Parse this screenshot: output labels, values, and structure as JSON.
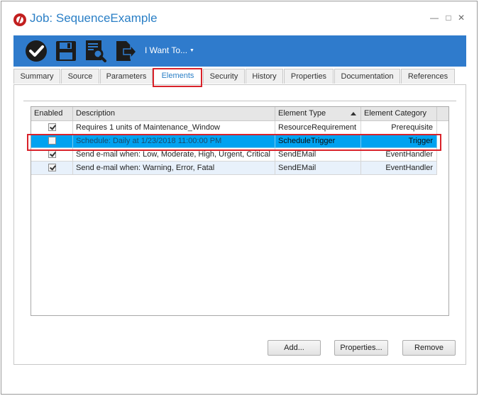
{
  "window": {
    "title": "Job: SequenceExample",
    "controls": [
      "minimize-icon",
      "maximize-icon",
      "close-icon"
    ]
  },
  "toolbar": {
    "icons": [
      "checkmark-icon",
      "save-icon",
      "search-report-icon",
      "export-icon"
    ],
    "menu_label": "I Want To...",
    "background_color": "#2f7bcc"
  },
  "tabs": [
    {
      "label": "Summary"
    },
    {
      "label": "Source"
    },
    {
      "label": "Parameters"
    },
    {
      "label": "Elements",
      "active": true
    },
    {
      "label": "Security"
    },
    {
      "label": "History"
    },
    {
      "label": "Properties"
    },
    {
      "label": "Documentation"
    },
    {
      "label": "References"
    }
  ],
  "grid": {
    "columns": [
      "Enabled",
      "Description",
      "Element Type",
      "Element Category"
    ],
    "sort_column": "Element Type",
    "rows": [
      {
        "enabled": true,
        "description": "Requires 1 units of Maintenance_Window",
        "type": "ResourceRequirement",
        "category": "Prerequisite"
      },
      {
        "enabled": false,
        "description": "Schedule: Daily at 1/23/2018 11:00:00 PM",
        "type": "ScheduleTrigger",
        "category": "Trigger",
        "selected": true
      },
      {
        "enabled": true,
        "description": "Send e-mail when: Low, Moderate, High, Urgent, Critical",
        "type": "SendEMail",
        "category": "EventHandler"
      },
      {
        "enabled": true,
        "description": "Send e-mail when: Warning, Error, Fatal",
        "type": "SendEMail",
        "category": "EventHandler"
      }
    ]
  },
  "buttons": {
    "add": "Add...",
    "properties": "Properties...",
    "remove": "Remove"
  },
  "colors": {
    "accent": "#2a7fc6",
    "selection": "#00a2f0",
    "highlight_annotation": "#d9222a"
  }
}
